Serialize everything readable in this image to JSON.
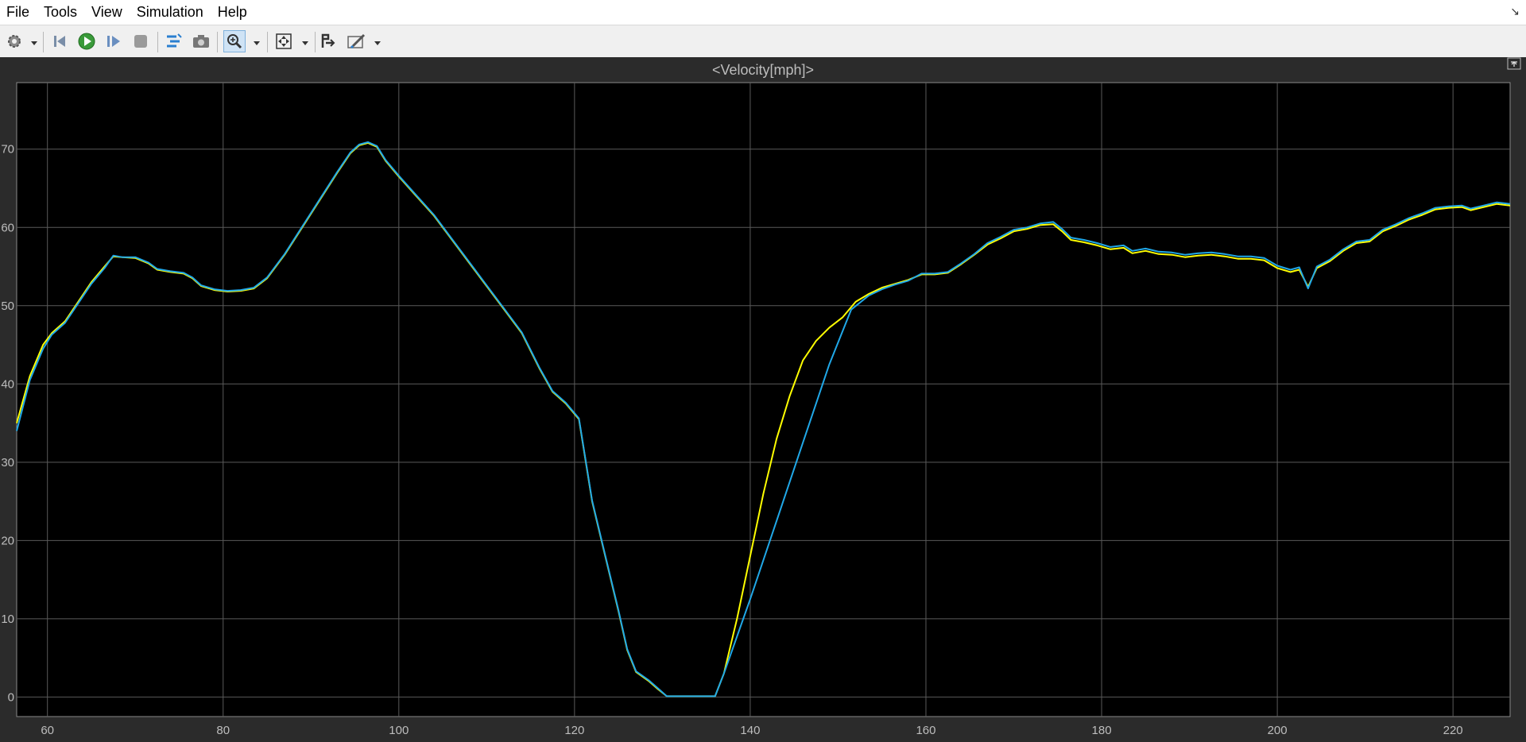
{
  "menu": [
    "File",
    "Tools",
    "View",
    "Simulation",
    "Help"
  ],
  "toolbar": {
    "icons": [
      "gear-icon",
      "step-back-icon",
      "run-icon",
      "step-forward-icon",
      "stop-icon",
      "highlight-icon",
      "camera-icon",
      "zoom-in-icon",
      "fit-icon",
      "signal-icon",
      "style-icon"
    ],
    "zoom_active": true
  },
  "colors": {
    "background": "#000000",
    "axes": "#2b2b2b",
    "grid": "#5a5a5a",
    "tick_text": "#bdbdbd",
    "series1": "#ffff00",
    "series2": "#20a8e8"
  },
  "chart_data": {
    "type": "line",
    "title": "<Velocity[mph]>",
    "xlabel": "",
    "ylabel": "",
    "xlim": [
      56.5,
      226.5
    ],
    "ylim": [
      -2.5,
      78.5
    ],
    "xticks": [
      60,
      80,
      100,
      120,
      140,
      160,
      180,
      200,
      220
    ],
    "yticks": [
      0,
      10,
      20,
      30,
      40,
      50,
      60,
      70
    ],
    "grid": true,
    "series": [
      {
        "color": "#ffff00",
        "points": [
          [
            56.5,
            35
          ],
          [
            58,
            41
          ],
          [
            59.5,
            45
          ],
          [
            60.5,
            46.5
          ],
          [
            62,
            48
          ],
          [
            63.5,
            50.5
          ],
          [
            65,
            53
          ],
          [
            66.5,
            55
          ],
          [
            67.5,
            56.3
          ],
          [
            68.5,
            56.2
          ],
          [
            70,
            56.1
          ],
          [
            71.5,
            55.4
          ],
          [
            72.5,
            54.6
          ],
          [
            74,
            54.3
          ],
          [
            75.5,
            54.1
          ],
          [
            76.5,
            53.5
          ],
          [
            77.5,
            52.5
          ],
          [
            79,
            52.0
          ],
          [
            80.5,
            51.8
          ],
          [
            82,
            51.9
          ],
          [
            83.5,
            52.2
          ],
          [
            85,
            53.5
          ],
          [
            87,
            56.5
          ],
          [
            89,
            60
          ],
          [
            91,
            63.5
          ],
          [
            93,
            67
          ],
          [
            94.5,
            69.5
          ],
          [
            95.5,
            70.5
          ],
          [
            96.5,
            70.8
          ],
          [
            97.5,
            70.3
          ],
          [
            98.5,
            68.5
          ],
          [
            100,
            66.5
          ],
          [
            102,
            64
          ],
          [
            104,
            61.5
          ],
          [
            106,
            58.5
          ],
          [
            108,
            55.5
          ],
          [
            110,
            52.5
          ],
          [
            112,
            49.5
          ],
          [
            114,
            46.5
          ],
          [
            116,
            42
          ],
          [
            117.5,
            39
          ],
          [
            119,
            37.5
          ],
          [
            120.5,
            35.5
          ],
          [
            122,
            25
          ],
          [
            123.5,
            18
          ],
          [
            125,
            11
          ],
          [
            126,
            6
          ],
          [
            127,
            3.2
          ],
          [
            128.5,
            2
          ],
          [
            129.5,
            1
          ],
          [
            130.5,
            0.1
          ],
          [
            133,
            0.1
          ],
          [
            136,
            0.1
          ],
          [
            137,
            3
          ],
          [
            138.5,
            10
          ],
          [
            140,
            18
          ],
          [
            141.5,
            26
          ],
          [
            143,
            33
          ],
          [
            144.5,
            38.5
          ],
          [
            146,
            43
          ],
          [
            147.5,
            45.5
          ],
          [
            149,
            47.2
          ],
          [
            150.5,
            48.5
          ],
          [
            152,
            50.5
          ],
          [
            153.5,
            51.5
          ],
          [
            155,
            52.3
          ],
          [
            156.5,
            52.8
          ],
          [
            158,
            53.3
          ],
          [
            159.5,
            54
          ],
          [
            161,
            54
          ],
          [
            162.5,
            54.2
          ],
          [
            164,
            55.3
          ],
          [
            165.5,
            56.5
          ],
          [
            167,
            57.8
          ],
          [
            168.5,
            58.6
          ],
          [
            170,
            59.5
          ],
          [
            171.5,
            59.8
          ],
          [
            173,
            60.3
          ],
          [
            174.5,
            60.4
          ],
          [
            175.5,
            59.5
          ],
          [
            176.5,
            58.4
          ],
          [
            178,
            58.1
          ],
          [
            179.5,
            57.7
          ],
          [
            181,
            57.2
          ],
          [
            182.5,
            57.4
          ],
          [
            183.5,
            56.7
          ],
          [
            185,
            57
          ],
          [
            186.5,
            56.6
          ],
          [
            188,
            56.5
          ],
          [
            189.5,
            56.2
          ],
          [
            191,
            56.4
          ],
          [
            192.5,
            56.5
          ],
          [
            194,
            56.3
          ],
          [
            195.5,
            56
          ],
          [
            197,
            56
          ],
          [
            198.5,
            55.8
          ],
          [
            200,
            54.8
          ],
          [
            201.5,
            54.3
          ],
          [
            202.5,
            54.6
          ],
          [
            203.5,
            52.4
          ],
          [
            204.5,
            54.8
          ],
          [
            206,
            55.7
          ],
          [
            207.5,
            57
          ],
          [
            209,
            58
          ],
          [
            210.5,
            58.2
          ],
          [
            212,
            59.5
          ],
          [
            213.5,
            60.2
          ],
          [
            215,
            61
          ],
          [
            216.5,
            61.6
          ],
          [
            218,
            62.3
          ],
          [
            219.5,
            62.5
          ],
          [
            221,
            62.6
          ],
          [
            222,
            62.2
          ],
          [
            223.5,
            62.6
          ],
          [
            225,
            63
          ],
          [
            226.5,
            62.8
          ]
        ]
      },
      {
        "color": "#20a8e8",
        "points": [
          [
            56.5,
            34
          ],
          [
            58,
            40.5
          ],
          [
            59.5,
            44.5
          ],
          [
            60.5,
            46.3
          ],
          [
            62,
            47.8
          ],
          [
            63.5,
            50.3
          ],
          [
            65,
            52.8
          ],
          [
            66.5,
            54.8
          ],
          [
            67.5,
            56.4
          ],
          [
            68.5,
            56.2
          ],
          [
            70,
            56.2
          ],
          [
            71.5,
            55.5
          ],
          [
            72.5,
            54.7
          ],
          [
            74,
            54.4
          ],
          [
            75.5,
            54.2
          ],
          [
            76.5,
            53.6
          ],
          [
            77.5,
            52.6
          ],
          [
            79,
            52.1
          ],
          [
            80.5,
            51.9
          ],
          [
            82,
            52.0
          ],
          [
            83.5,
            52.3
          ],
          [
            85,
            53.6
          ],
          [
            87,
            56.6
          ],
          [
            89,
            60.1
          ],
          [
            91,
            63.6
          ],
          [
            93,
            67.1
          ],
          [
            94.5,
            69.6
          ],
          [
            95.5,
            70.6
          ],
          [
            96.5,
            70.9
          ],
          [
            97.5,
            70.4
          ],
          [
            98.5,
            68.6
          ],
          [
            100,
            66.6
          ],
          [
            102,
            64.1
          ],
          [
            104,
            61.6
          ],
          [
            106,
            58.6
          ],
          [
            108,
            55.6
          ],
          [
            110,
            52.6
          ],
          [
            112,
            49.6
          ],
          [
            114,
            46.6
          ],
          [
            116,
            42.1
          ],
          [
            117.5,
            39.1
          ],
          [
            119,
            37.6
          ],
          [
            120.5,
            35.6
          ],
          [
            122,
            25.1
          ],
          [
            123.5,
            18.1
          ],
          [
            125,
            11.1
          ],
          [
            126,
            6.1
          ],
          [
            127,
            3.3
          ],
          [
            128.5,
            2.1
          ],
          [
            129.5,
            1.1
          ],
          [
            130.5,
            0.1
          ],
          [
            133,
            0.1
          ],
          [
            136,
            0.1
          ],
          [
            137,
            3
          ],
          [
            140,
            12.5
          ],
          [
            143,
            22.5
          ],
          [
            146,
            32.5
          ],
          [
            149,
            42.5
          ],
          [
            151.5,
            49.5
          ],
          [
            153.5,
            51.3
          ],
          [
            155,
            52.1
          ],
          [
            156.5,
            52.7
          ],
          [
            158,
            53.2
          ],
          [
            159.5,
            54.1
          ],
          [
            161,
            54.1
          ],
          [
            162.5,
            54.3
          ],
          [
            164,
            55.4
          ],
          [
            165.5,
            56.6
          ],
          [
            167,
            58.0
          ],
          [
            168.5,
            58.8
          ],
          [
            170,
            59.7
          ],
          [
            171.5,
            60.0
          ],
          [
            173,
            60.5
          ],
          [
            174.5,
            60.7
          ],
          [
            175.5,
            59.8
          ],
          [
            176.5,
            58.7
          ],
          [
            178,
            58.4
          ],
          [
            179.5,
            58.0
          ],
          [
            181,
            57.5
          ],
          [
            182.5,
            57.7
          ],
          [
            183.5,
            57.0
          ],
          [
            185,
            57.3
          ],
          [
            186.5,
            56.9
          ],
          [
            188,
            56.8
          ],
          [
            189.5,
            56.5
          ],
          [
            191,
            56.7
          ],
          [
            192.5,
            56.8
          ],
          [
            194,
            56.6
          ],
          [
            195.5,
            56.3
          ],
          [
            197,
            56.3
          ],
          [
            198.5,
            56.1
          ],
          [
            200,
            55.1
          ],
          [
            201.5,
            54.6
          ],
          [
            202.5,
            54.9
          ],
          [
            203.5,
            52.2
          ],
          [
            204.5,
            55.0
          ],
          [
            206,
            55.9
          ],
          [
            207.5,
            57.2
          ],
          [
            209,
            58.2
          ],
          [
            210.5,
            58.4
          ],
          [
            212,
            59.7
          ],
          [
            213.5,
            60.4
          ],
          [
            215,
            61.2
          ],
          [
            216.5,
            61.8
          ],
          [
            218,
            62.5
          ],
          [
            219.5,
            62.7
          ],
          [
            221,
            62.8
          ],
          [
            222,
            62.4
          ],
          [
            223.5,
            62.8
          ],
          [
            225,
            63.2
          ],
          [
            226.5,
            63.0
          ]
        ]
      }
    ]
  }
}
